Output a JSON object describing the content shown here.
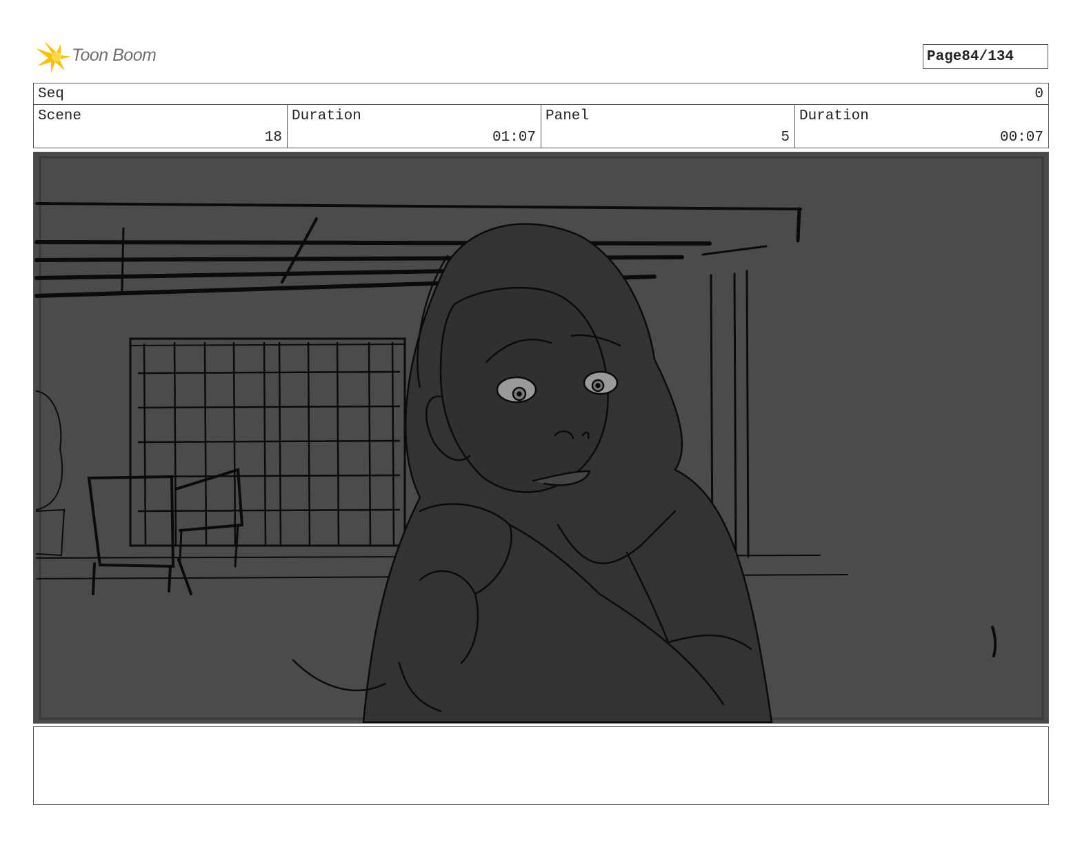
{
  "header": {
    "brand": "Toon Boom",
    "page_label": "Page",
    "page_value": "84/134"
  },
  "seq": {
    "label": "Seq",
    "value": "0"
  },
  "info": {
    "scene_label": "Scene",
    "scene_value": "18",
    "scene_duration_label": "Duration",
    "scene_duration_value": "01:07",
    "panel_label": "Panel",
    "panel_value": "5",
    "panel_duration_label": "Duration",
    "panel_duration_value": "00:07"
  },
  "notes": {
    "text": ""
  }
}
